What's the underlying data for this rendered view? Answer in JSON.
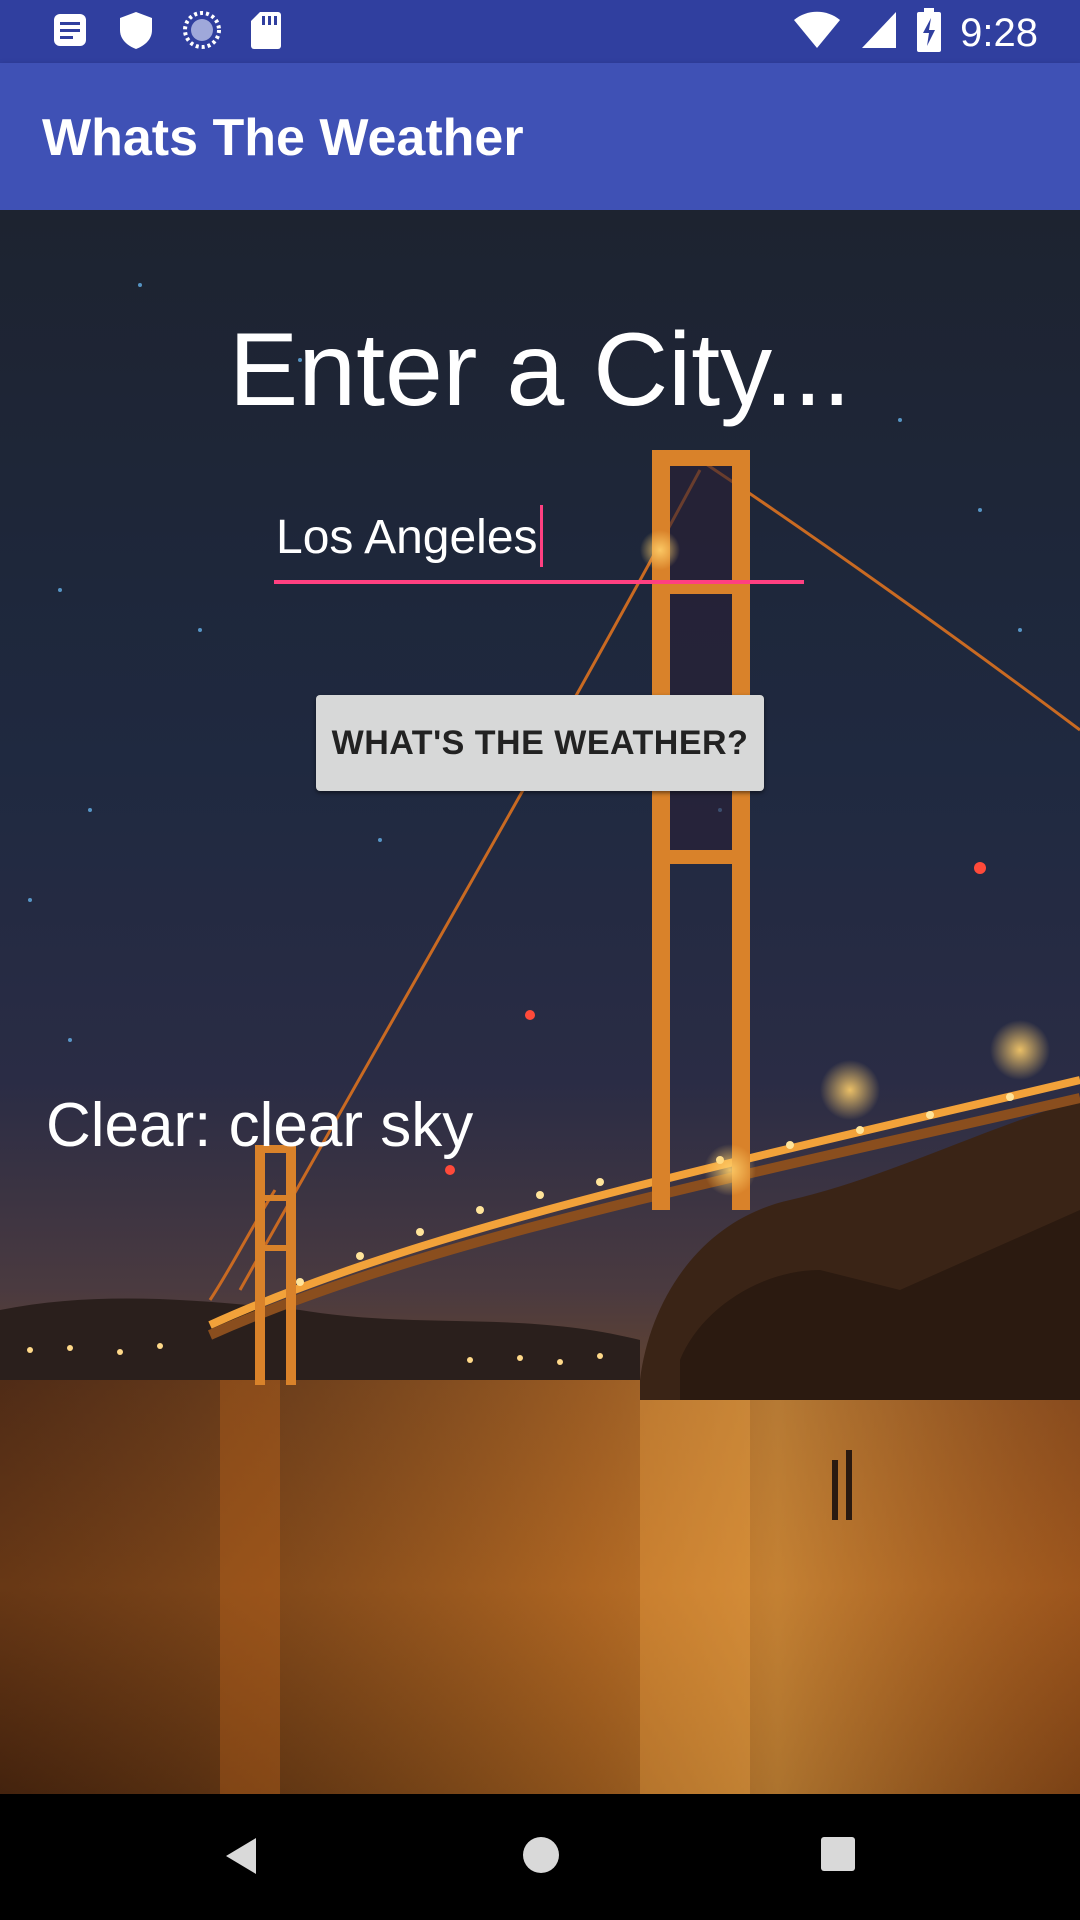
{
  "status_bar": {
    "time": "9:28",
    "left_icons": [
      "notification-icon",
      "shield-icon",
      "sync-icon",
      "sd-card-icon"
    ],
    "right_icons": [
      "wifi-icon",
      "signal-icon",
      "battery-charging-icon"
    ]
  },
  "app_bar": {
    "title": "Whats The Weather",
    "color": "#3f51b5"
  },
  "main": {
    "heading": "Enter a City...",
    "city_input": {
      "value": "Los Angeles",
      "accent": "#ff4081"
    },
    "button_label": "WHAT'S THE WEATHER?",
    "result_text": "Clear: clear sky"
  },
  "nav_bar": {
    "icons": [
      "back-icon",
      "home-icon",
      "recents-icon"
    ]
  }
}
